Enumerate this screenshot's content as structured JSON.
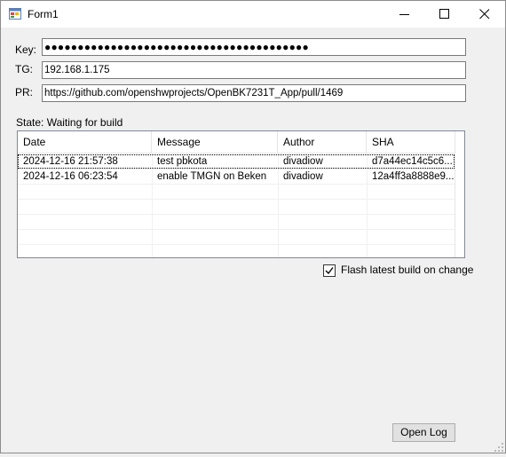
{
  "window": {
    "title": "Form1"
  },
  "fields": {
    "key_label": "Key:",
    "key_value": "●●●●●●●●●●●●●●●●●●●●●●●●●●●●●●●●●●●●●●●●",
    "tg_label": "TG:",
    "tg_value": "192.168.1.175",
    "pr_label": "PR:",
    "pr_value": "https://github.com/openshwprojects/OpenBK7231T_App/pull/1469"
  },
  "state": {
    "text": "State: Waiting for build"
  },
  "grid": {
    "columns": [
      "Date",
      "Message",
      "Author",
      "SHA"
    ],
    "rows": [
      {
        "date": "2024-12-16 21:57:38",
        "message": "test pbkota",
        "author": "divadiow",
        "sha": "d7a44ec14c5c6..."
      },
      {
        "date": "2024-12-16 06:23:54",
        "message": "enable TMGN on Beken",
        "author": "divadiow",
        "sha": "12a4ff3a8888e9..."
      }
    ]
  },
  "options": {
    "flash_label": "Flash latest build on change",
    "flash_checked": true
  },
  "buttons": {
    "open_log": "Open Log"
  },
  "icons": {
    "app": "form-app-icon",
    "minimize": "minimize-icon",
    "maximize": "maximize-icon",
    "close": "close-icon",
    "check": "checkmark-icon",
    "grip": "size-grip-icon"
  }
}
